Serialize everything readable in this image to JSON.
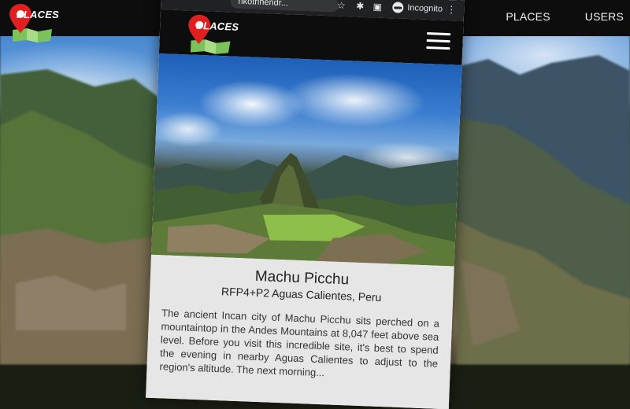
{
  "background_page": {
    "logo_text": "PLACES",
    "nav_links": [
      "PLACES",
      "USERS"
    ]
  },
  "browser": {
    "url": "rikotrihendr...",
    "incognito_label": "Incognito",
    "icons": [
      "star-icon",
      "extension-icon",
      "reading-list-icon",
      "incognito-icon",
      "kebab-menu-icon"
    ]
  },
  "app": {
    "logo_text": "PLACES",
    "menu_icon": "hamburger-menu-icon"
  },
  "place": {
    "title": "Machu Picchu",
    "address": "RFP4+P2 Aguas Calientes, Peru",
    "description": "The ancient Incan city of Machu Picchu sits perched on a mountaintop in the Andes Mountains at 8,047 feet above sea level. Before you visit this incredible site, it's best to spend the evening in nearby Aguas Calientes to adjust to the region's altitude. The next morning..."
  },
  "colors": {
    "nav_bg": "#0d0d0d",
    "marker_red": "#e02020",
    "map_green": "#7cc25a",
    "card_bg": "#e6e6e6"
  }
}
